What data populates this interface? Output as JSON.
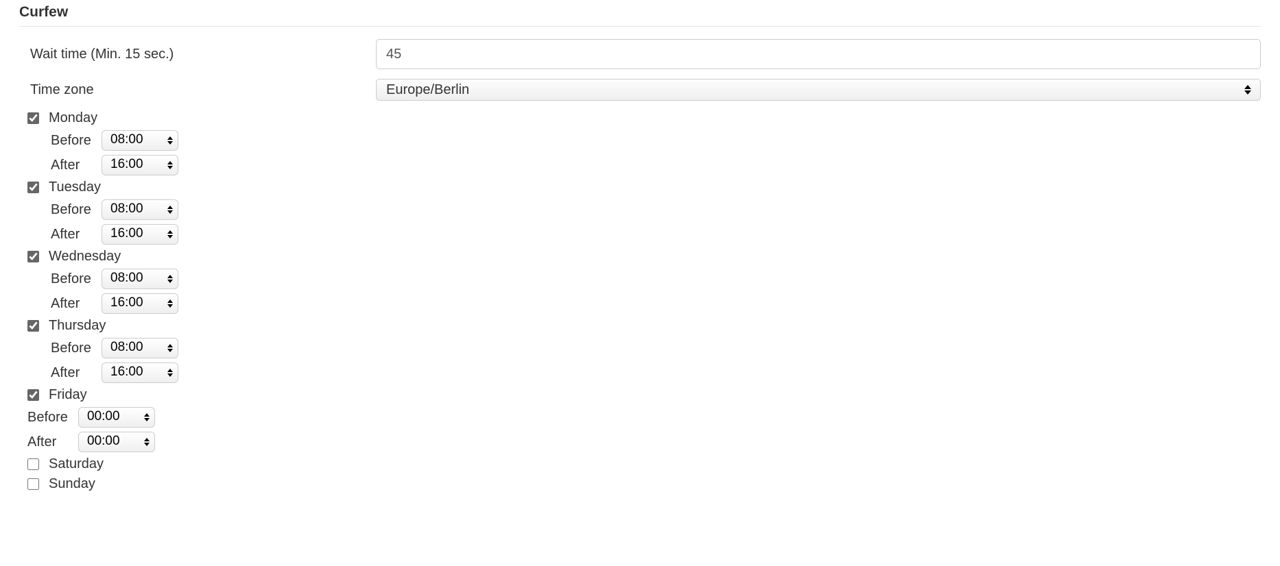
{
  "section": {
    "title": "Curfew"
  },
  "waitTime": {
    "label": "Wait time (Min. 15 sec.)",
    "value": "45"
  },
  "timeZone": {
    "label": "Time zone",
    "value": "Europe/Berlin"
  },
  "labels": {
    "before": "Before",
    "after": "After"
  },
  "days": [
    {
      "name": "Monday",
      "checked": true,
      "before": "08:00",
      "after": "16:00",
      "indent": true
    },
    {
      "name": "Tuesday",
      "checked": true,
      "before": "08:00",
      "after": "16:00",
      "indent": true
    },
    {
      "name": "Wednesday",
      "checked": true,
      "before": "08:00",
      "after": "16:00",
      "indent": true
    },
    {
      "name": "Thursday",
      "checked": true,
      "before": "08:00",
      "after": "16:00",
      "indent": true
    },
    {
      "name": "Friday",
      "checked": true,
      "before": "00:00",
      "after": "00:00",
      "indent": false
    },
    {
      "name": "Saturday",
      "checked": false
    },
    {
      "name": "Sunday",
      "checked": false
    }
  ]
}
